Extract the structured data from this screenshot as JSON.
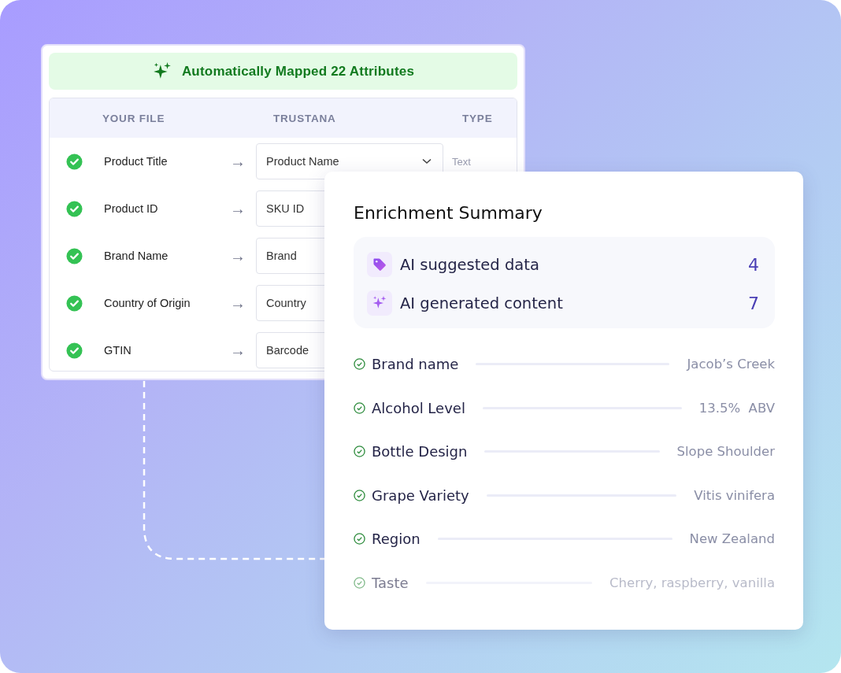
{
  "mapping": {
    "banner": "Automatically Mapped 22 Attributes",
    "columns": [
      "YOUR FILE",
      "TRUSTANA",
      "TYPE"
    ],
    "rows": [
      {
        "source": "Product Title",
        "arrow": "→",
        "target": "Product Name",
        "type": "Text",
        "mapped": true
      },
      {
        "source": "Product ID",
        "arrow": "→",
        "target": "SKU ID",
        "mapped": true
      },
      {
        "source": "Brand Name",
        "arrow": "→",
        "target": "Brand",
        "mapped": true
      },
      {
        "source": "Country of Origin",
        "arrow": "→",
        "target": "Country",
        "mapped": true
      },
      {
        "source": "GTIN",
        "arrow": "→",
        "target": "Barcode",
        "mapped": true
      }
    ]
  },
  "summary": {
    "title": "Enrichment Summary",
    "stats": [
      {
        "kind": "tag",
        "label": "AI suggested data",
        "count": "4"
      },
      {
        "kind": "sparkle",
        "label": "AI generated content",
        "count": "7"
      }
    ],
    "attributes": [
      {
        "label": "Brand name",
        "value": "Jacob’s Creek",
        "faded": false
      },
      {
        "label": "Alcohol Level",
        "value": "13.5%  ABV",
        "faded": false
      },
      {
        "label": "Bottle Design",
        "value": "Slope Shoulder",
        "faded": false
      },
      {
        "label": "Grape Variety",
        "value": "Vitis vinifera",
        "faded": false
      },
      {
        "label": "Region",
        "value": "New Zealand",
        "faded": false
      },
      {
        "label": "Taste",
        "value": "Cherry, raspberry, vanilla",
        "faded": true
      }
    ]
  }
}
